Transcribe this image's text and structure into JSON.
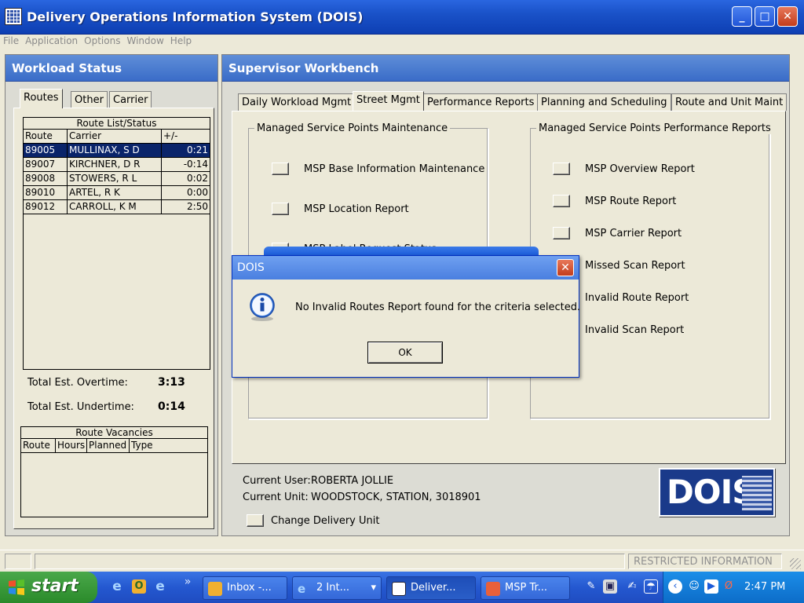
{
  "window": {
    "title": "Delivery Operations Information System (DOIS)",
    "min": "_",
    "max": "□",
    "close": "✕"
  },
  "menu": [
    "File",
    "Application",
    "Options",
    "Window",
    "Help"
  ],
  "workload": {
    "title": "Workload Status",
    "tabs": [
      "Routes",
      "Other",
      "Carrier"
    ],
    "route_list": {
      "caption": "Route List/Status",
      "columns": [
        "Route",
        "Carrier",
        "+/-"
      ],
      "rows": [
        {
          "route": "89005",
          "carrier": "MULLINAX, S D",
          "diff": "0:21"
        },
        {
          "route": "89007",
          "carrier": "KIRCHNER, D R",
          "diff": "-0:14"
        },
        {
          "route": "89008",
          "carrier": "STOWERS, R L",
          "diff": "0:02"
        },
        {
          "route": "89010",
          "carrier": "ARTEL, R K",
          "diff": "0:00"
        },
        {
          "route": "89012",
          "carrier": "CARROLL, K M",
          "diff": "2:50"
        }
      ]
    },
    "overtime_label": "Total Est. Overtime:",
    "overtime_value": "3:13",
    "undertime_label": "Total Est. Undertime:",
    "undertime_value": "0:14",
    "vacancies": {
      "caption": "Route Vacancies",
      "columns": [
        "Route",
        "Hours",
        "Planned",
        "Type"
      ]
    }
  },
  "workbench": {
    "title": "Supervisor Workbench",
    "tabs": [
      "Daily Workload Mgmt",
      "Street Mgmt",
      "Performance Reports",
      "Planning and Scheduling",
      "Route and Unit Maint"
    ],
    "left_group": {
      "title": "Managed Service Points Maintenance",
      "buttons": [
        "MSP Base Information Maintenance",
        "MSP Location Report",
        "MSP Label Request Status"
      ]
    },
    "right_group": {
      "title": "Managed Service Points Performance Reports",
      "buttons": [
        "MSP Overview Report",
        "MSP Route Report",
        "MSP Carrier Report",
        "Missed Scan Report",
        "Invalid Route Report",
        "Invalid Scan Report"
      ]
    },
    "current_user_label": "Current User:",
    "current_user": "ROBERTA JOLLIE",
    "current_unit_label": "Current Unit:",
    "current_unit": "WOODSTOCK, STATION, 3018901",
    "change_unit": "Change Delivery Unit",
    "logo": "DOIS"
  },
  "dialog": {
    "title": "DOIS",
    "message": "No Invalid Routes Report found for the criteria selected.",
    "ok": "OK",
    "icon": "info-icon"
  },
  "status_bar": {
    "text": "RESTRICTED INFORMATION"
  },
  "taskbar": {
    "start": "start",
    "tasks": [
      "Inbox -...",
      "2 Int...",
      "Deliver...",
      "MSP Tr..."
    ],
    "clock": "2:47 PM"
  }
}
